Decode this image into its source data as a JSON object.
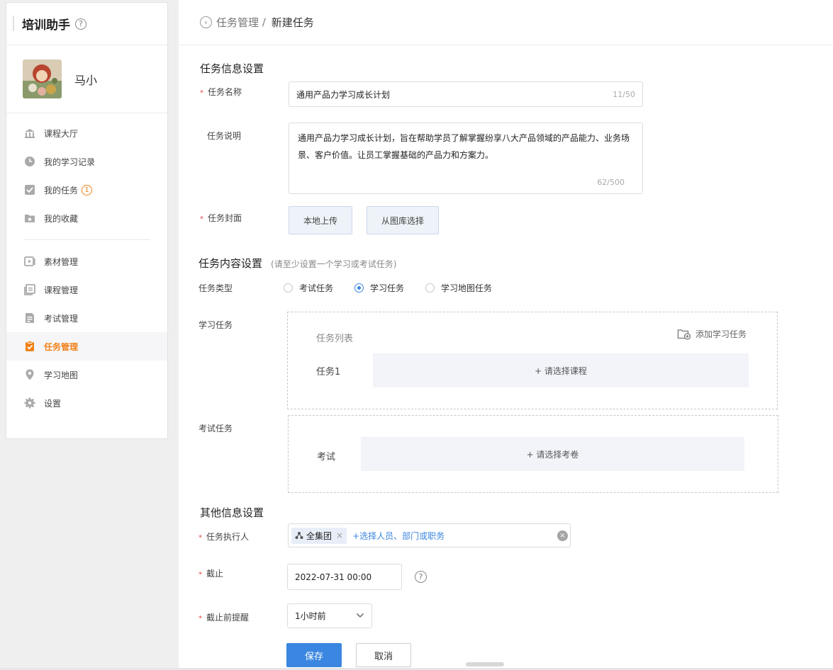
{
  "sidebar": {
    "title": "培训助手",
    "help_glyph": "?",
    "user_name": "马小",
    "menu_group1": [
      {
        "label": "课程大厅",
        "icon": "bank-icon"
      },
      {
        "label": "我的学习记录",
        "icon": "clock-icon"
      },
      {
        "label": "我的任务",
        "icon": "check-square-icon",
        "badge": "1"
      },
      {
        "label": "我的收藏",
        "icon": "star-folder-icon"
      }
    ],
    "menu_group2": [
      {
        "label": "素材管理",
        "icon": "play-box-icon"
      },
      {
        "label": "课程管理",
        "icon": "layers-icon"
      },
      {
        "label": "考试管理",
        "icon": "exam-icon"
      },
      {
        "label": "任务管理",
        "icon": "clipboard-check-icon",
        "active": true
      },
      {
        "label": "学习地图",
        "icon": "map-pin-icon"
      },
      {
        "label": "设置",
        "icon": "gear-icon"
      }
    ]
  },
  "breadcrumb": {
    "parent": "任务管理",
    "separator": "/",
    "current": "新建任务"
  },
  "info_section": {
    "title": "任务信息设置",
    "name_label": "任务名称",
    "name_value": "通用产品力学习成长计划",
    "name_counter": "11/50",
    "desc_label": "任务说明",
    "desc_value": "通用产品力学习成长计划，旨在帮助学员了解掌握纷享八大产品领域的产品能力、业务场景、客户价值。让员工掌握基础的产品力和方案力。",
    "desc_counter": "62/500",
    "cover_label": "任务封面",
    "upload_local": "本地上传",
    "choose_gallery": "从图库选择"
  },
  "content_section": {
    "title": "任务内容设置",
    "note": "(请至少设置一个学习或考试任务)",
    "type_label": "任务类型",
    "types": [
      {
        "label": "考试任务",
        "selected": false
      },
      {
        "label": "学习任务",
        "selected": true
      },
      {
        "label": "学习地图任务",
        "selected": false
      }
    ],
    "study_label": "学习任务",
    "task_list_title": "任务列表",
    "add_study": "添加学习任务",
    "task1_label": "任务1",
    "choose_course": "+ 请选择课程",
    "exam_label": "考试任务",
    "exam_item_label": "考试",
    "choose_paper": "+ 请选择考卷"
  },
  "other_section": {
    "title": "其他信息设置",
    "executor_label": "任务执行人",
    "executor_tag": "全集团",
    "executor_add": "+选择人员、部门或职务",
    "deadline_label": "截止",
    "deadline_value": "2022-07-31 00:00",
    "remind_label": "截止前提醒",
    "remind_value": "1小时前"
  },
  "actions": {
    "save": "保存",
    "cancel": "取消"
  },
  "colors": {
    "accent": "#f0811a",
    "primary": "#3a86e0",
    "required": "#e4493e"
  }
}
